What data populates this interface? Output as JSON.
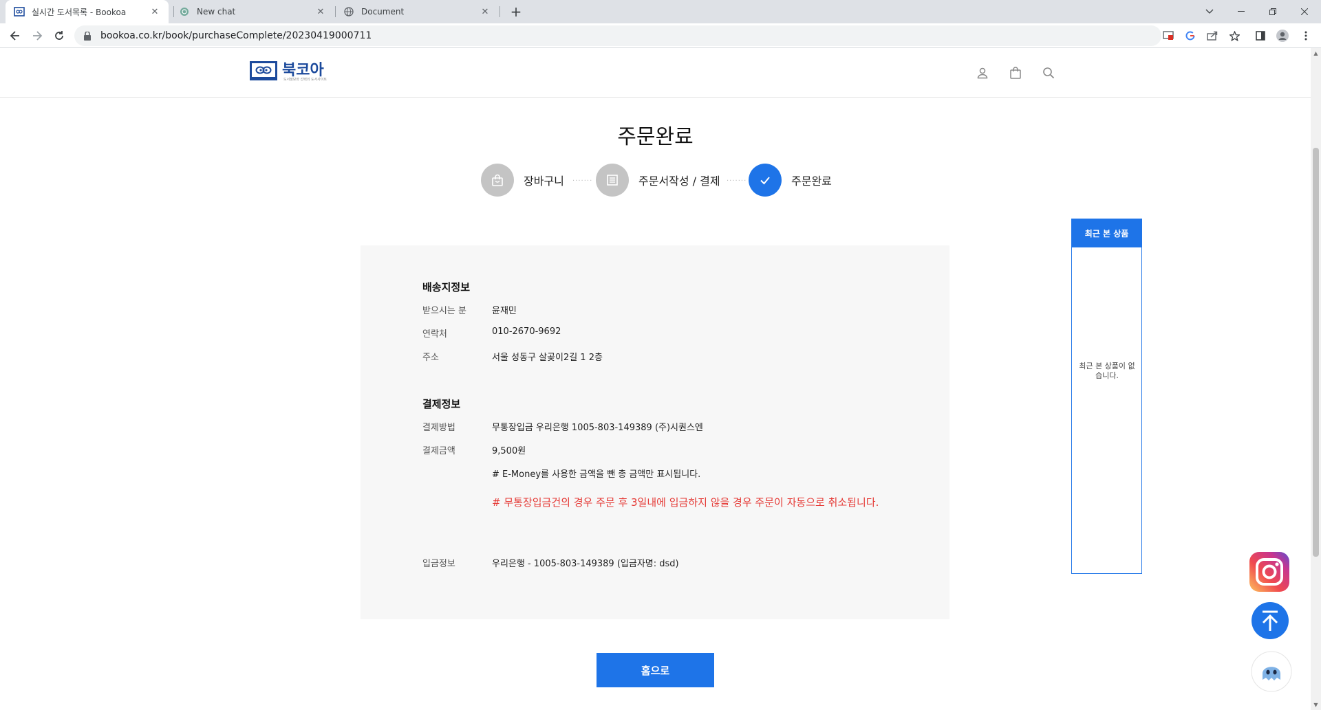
{
  "browser": {
    "tabs": [
      {
        "title": "실시간 도서목록 - Bookoa",
        "active": true
      },
      {
        "title": "New chat",
        "active": false
      },
      {
        "title": "Document",
        "active": false
      }
    ],
    "close_glyph": "✕",
    "new_tab_glyph": "+",
    "url": "bookoa.co.kr/book/purchaseComplete/20230419000711"
  },
  "header": {
    "logo_text": "북코아",
    "logo_tagline": "도서정보와 선택의 도서사이트"
  },
  "page": {
    "title": "주문완료",
    "steps": [
      {
        "label": "장바구니",
        "icon": "shopping-bag-icon",
        "active": false
      },
      {
        "label": "주문서작성 / 결제",
        "icon": "document-icon",
        "active": false
      },
      {
        "label": "주문완료",
        "icon": "check-icon",
        "active": true
      }
    ],
    "step_separator": "·······"
  },
  "shipping": {
    "title": "배송지정보",
    "rows": [
      {
        "label": "받으시는 분",
        "value": "윤재민"
      },
      {
        "label": "연락처",
        "value": "010-2670-9692"
      },
      {
        "label": "주소",
        "value": "서울 성동구 살곶이2길 1 2층"
      }
    ]
  },
  "payment": {
    "title": "결제정보",
    "method_label": "결제방법",
    "method_value": "무통장입금 우리은행 1005-803-149389 (주)시퀀스엔",
    "amount_label": "결제금액",
    "amount_value": "9,500원",
    "emoney_note": "# E-Money를 사용한 금액을 뺀 총 금액만 표시됩니다.",
    "cancel_notice": "# 무통장입금건의 경우 주문 후 3일내에 입금하지 않을 경우 주문이 자동으로 취소됩니다.",
    "deposit_label": "입금정보",
    "deposit_value": "우리은행 - 1005-803-149389 (입금자명: dsd)"
  },
  "home_button": "홈으로",
  "recent": {
    "title": "최근 본 상품",
    "empty": "최근 본 상품이 없습니다."
  },
  "colors": {
    "accent": "#1e74e8",
    "notice": "#e53935",
    "box_bg": "#f7f7f7"
  }
}
